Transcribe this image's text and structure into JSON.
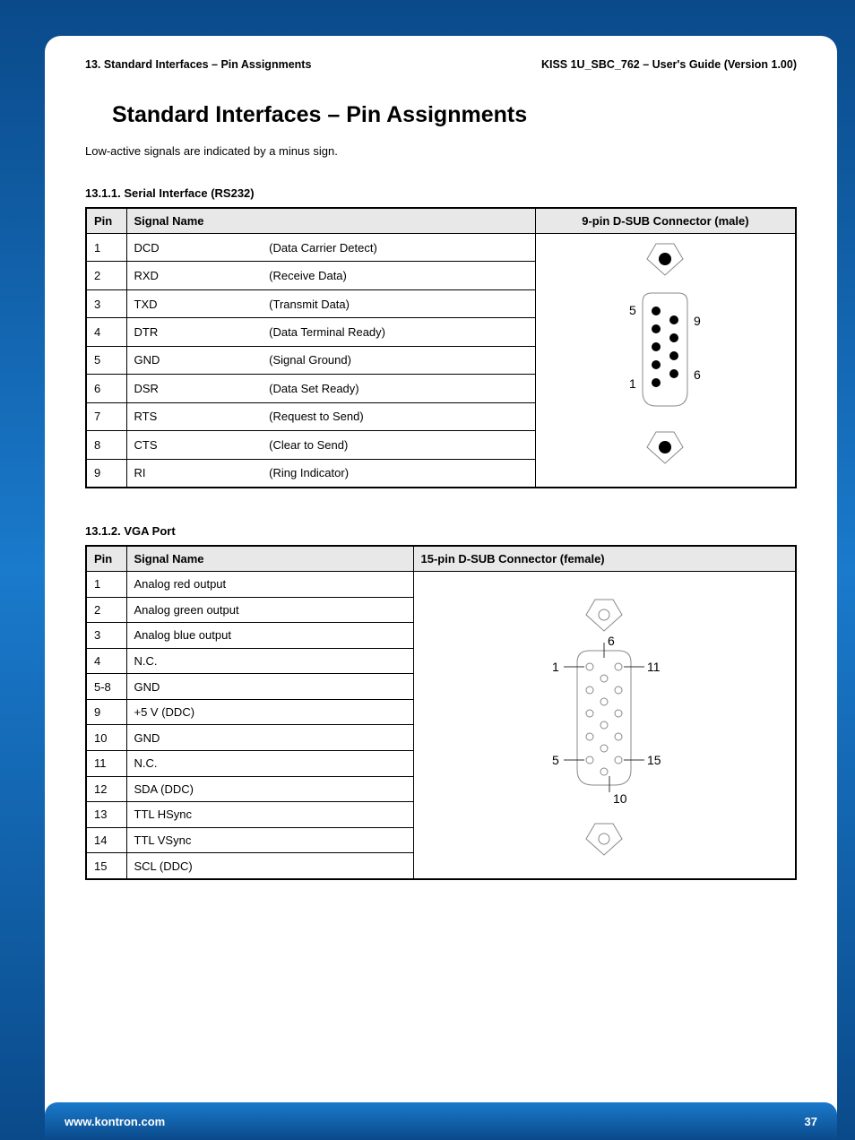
{
  "header": {
    "left": "13. Standard Interfaces – Pin Assignments",
    "right": "KISS 1U_SBC_762 – User's Guide (Version 1.00)"
  },
  "title": "Standard Interfaces – Pin Assignments",
  "intro": "Low-active signals are indicated by a minus sign.",
  "sections": {
    "serial": {
      "heading": "13.1.1. Serial Interface (RS232)",
      "columns": {
        "pin": "Pin",
        "signal": "Signal Name",
        "diagram": "9-pin D-SUB Connector (male)"
      },
      "rows": [
        {
          "pin": "1",
          "abbr": "DCD",
          "desc": "(Data Carrier Detect)"
        },
        {
          "pin": "2",
          "abbr": "RXD",
          "desc": "(Receive Data)"
        },
        {
          "pin": "3",
          "abbr": "TXD",
          "desc": "(Transmit Data)"
        },
        {
          "pin": "4",
          "abbr": "DTR",
          "desc": "(Data Terminal Ready)"
        },
        {
          "pin": "5",
          "abbr": "GND",
          "desc": "(Signal Ground)"
        },
        {
          "pin": "6",
          "abbr": "DSR",
          "desc": "(Data Set Ready)"
        },
        {
          "pin": "7",
          "abbr": "RTS",
          "desc": "(Request to Send)"
        },
        {
          "pin": "8",
          "abbr": "CTS",
          "desc": "(Clear to Send)"
        },
        {
          "pin": "9",
          "abbr": "RI",
          "desc": "(Ring Indicator)"
        }
      ],
      "diagram_labels": {
        "top": "5",
        "bottom": "1",
        "right_top": "9",
        "right_bottom": "6"
      }
    },
    "vga": {
      "heading": "13.1.2. VGA Port",
      "columns": {
        "pin": "Pin",
        "signal": "Signal Name",
        "diagram": "15-pin D-SUB Connector (female)"
      },
      "rows": [
        {
          "pin": "1",
          "signal": "Analog red output"
        },
        {
          "pin": "2",
          "signal": "Analog green output"
        },
        {
          "pin": "3",
          "signal": "Analog blue output"
        },
        {
          "pin": "4",
          "signal": "N.C."
        },
        {
          "pin": "5-8",
          "signal": "GND"
        },
        {
          "pin": "9",
          "signal": "+5 V (DDC)"
        },
        {
          "pin": "10",
          "signal": "GND"
        },
        {
          "pin": "11",
          "signal": "N.C."
        },
        {
          "pin": "12",
          "signal": "SDA (DDC)"
        },
        {
          "pin": "13",
          "signal": "TTL HSync"
        },
        {
          "pin": "14",
          "signal": "TTL VSync"
        },
        {
          "pin": "15",
          "signal": "SCL (DDC)"
        }
      ],
      "diagram_labels": {
        "l1": "1",
        "l5": "5",
        "t6": "6",
        "t10": "10",
        "r11": "11",
        "r15": "15"
      }
    }
  },
  "footer": {
    "url": "www.kontron.com",
    "page": "37"
  }
}
